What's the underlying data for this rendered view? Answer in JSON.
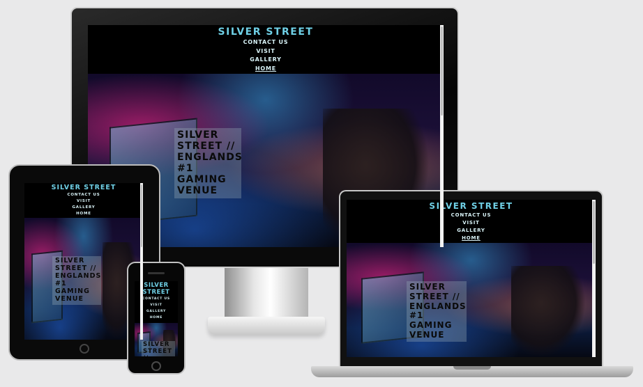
{
  "site": {
    "brand": "SILVER STREET",
    "nav": [
      "CONTACT US",
      "VISIT",
      "GALLERY",
      "HOME"
    ],
    "hero_caption": [
      "SILVER",
      "STREET //",
      "ENGLANDS",
      "#1",
      "GAMING",
      "VENUE"
    ]
  },
  "colors": {
    "background": "#e9e9ea",
    "brand_text": "#6fd0e6",
    "nav_text": "#d9f3f8",
    "site_background": "#000000"
  },
  "devices": [
    "desktop-monitor",
    "laptop",
    "tablet",
    "phone"
  ]
}
